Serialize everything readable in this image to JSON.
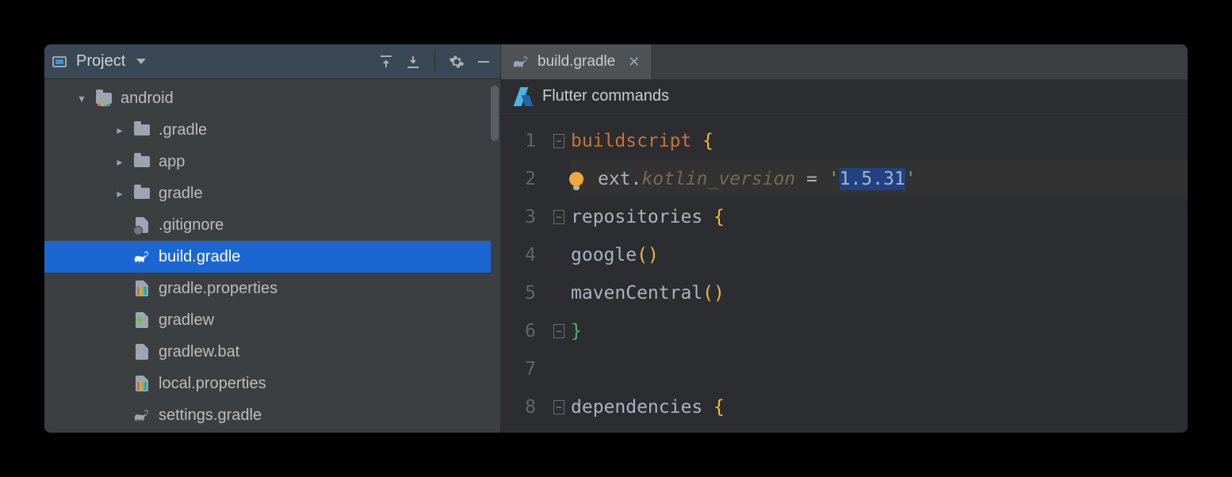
{
  "sidebar": {
    "title": "Project",
    "tree": [
      {
        "label": "android",
        "icon": "module-folder",
        "depth": 0,
        "expand": "open"
      },
      {
        "label": ".gradle",
        "icon": "folder",
        "depth": 1,
        "expand": "closed"
      },
      {
        "label": "app",
        "icon": "folder",
        "depth": 1,
        "expand": "closed"
      },
      {
        "label": "gradle",
        "icon": "folder",
        "depth": 1,
        "expand": "closed"
      },
      {
        "label": ".gitignore",
        "icon": "ignored-file",
        "depth": 1
      },
      {
        "label": "build.gradle",
        "icon": "gradle",
        "depth": 1,
        "selected": true
      },
      {
        "label": "gradle.properties",
        "icon": "props-file",
        "depth": 1
      },
      {
        "label": "gradlew",
        "icon": "exec-file",
        "depth": 1
      },
      {
        "label": "gradlew.bat",
        "icon": "text-file",
        "depth": 1
      },
      {
        "label": "local.properties",
        "icon": "props-file",
        "depth": 1
      },
      {
        "label": "settings.gradle",
        "icon": "gradle",
        "depth": 1
      }
    ]
  },
  "tab": {
    "label": "build.gradle"
  },
  "banner": {
    "label": "Flutter commands"
  },
  "code": {
    "line_numbers": [
      "1",
      "2",
      "3",
      "4",
      "5",
      "6",
      "7",
      "8"
    ],
    "folds": [
      "open",
      "",
      "open",
      "",
      "",
      "close",
      "",
      "open"
    ],
    "l1": {
      "a": "buildscript ",
      "b": "{"
    },
    "l2": {
      "a": "ext",
      "b": ".",
      "c": "kotlin_version ",
      "d": "= ",
      "e": "'",
      "f": "1.5.31",
      "g": "'"
    },
    "l3": {
      "a": "repositories ",
      "b": "{"
    },
    "l4": {
      "a": "google",
      "b": "()"
    },
    "l5": {
      "a": "mavenCentral",
      "b": "()"
    },
    "l6": {
      "a": "}"
    },
    "l8": {
      "a": "dependencies ",
      "b": "{"
    }
  }
}
